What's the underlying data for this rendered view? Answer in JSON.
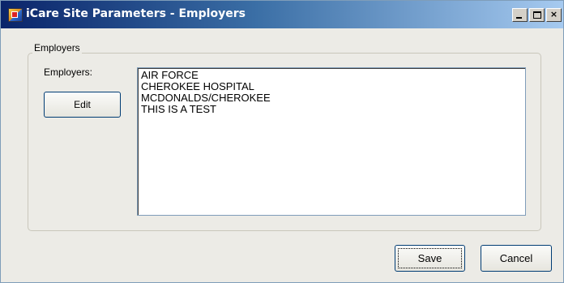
{
  "window": {
    "title": "iCare Site Parameters - Employers",
    "controls": {
      "minimize": "_",
      "maximize": "□",
      "close": "×"
    }
  },
  "group": {
    "legend": "Employers",
    "employers_label": "Employers:",
    "edit_label": "Edit",
    "employers": [
      "AIR FORCE",
      "CHEROKEE HOSPITAL",
      "MCDONALDS/CHEROKEE",
      "THIS IS A TEST"
    ]
  },
  "footer": {
    "save_label": "Save",
    "cancel_label": "Cancel"
  },
  "colors": {
    "titlebar_start": "#0a246a",
    "titlebar_end": "#a6caf0",
    "dialog_background": "#ecebe6"
  }
}
